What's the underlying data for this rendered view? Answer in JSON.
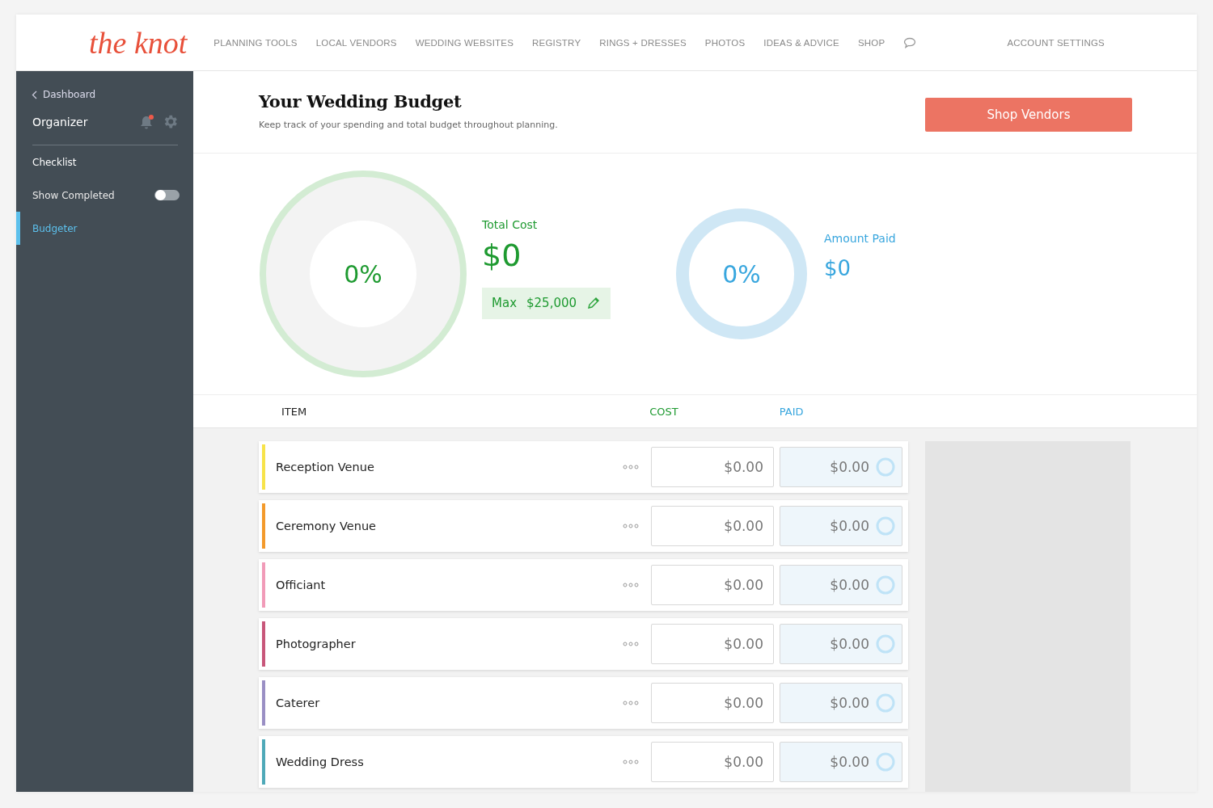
{
  "header": {
    "logo": "the knot",
    "nav": [
      "PLANNING TOOLS",
      "LOCAL VENDORS",
      "WEDDING WEBSITES",
      "REGISTRY",
      "RINGS + DRESSES",
      "PHOTOS",
      "IDEAS & ADVICE",
      "SHOP"
    ],
    "account": "ACCOUNT SETTINGS"
  },
  "sidebar": {
    "back": "Dashboard",
    "title": "Organizer",
    "notification": true,
    "items": [
      {
        "label": "Checklist",
        "kind": "link",
        "selected": false
      },
      {
        "label": "Show Completed",
        "kind": "toggle",
        "on": false
      },
      {
        "label": "Budgeter",
        "kind": "link",
        "selected": true
      }
    ]
  },
  "page": {
    "title": "Your Wedding Budget",
    "subtitle": "Keep track of your spending and total budget throughout planning.",
    "action": "Shop Vendors"
  },
  "total": {
    "percent": "0%",
    "level": 0,
    "label": "Total Cost",
    "amount": "$0",
    "max_label": "Max",
    "max_amount": "$25,000"
  },
  "paid": {
    "percent": "0%",
    "level": 0,
    "label": "Amount Paid",
    "amount": "$0"
  },
  "table": {
    "columns": [
      "ITEM",
      "COST",
      "PAID"
    ],
    "rows": [
      {
        "name": "Reception Venue",
        "color": "#f7e34a",
        "cost": "$0.00",
        "paid": "$0.00"
      },
      {
        "name": "Ceremony Venue",
        "color": "#f39a2b",
        "cost": "$0.00",
        "paid": "$0.00"
      },
      {
        "name": "Officiant",
        "color": "#f19bb8",
        "cost": "$0.00",
        "paid": "$0.00"
      },
      {
        "name": "Photographer",
        "color": "#c8577a",
        "cost": "$0.00",
        "paid": "$0.00"
      },
      {
        "name": "Caterer",
        "color": "#9a8fc4",
        "cost": "$0.00",
        "paid": "$0.00"
      },
      {
        "name": "Wedding Dress",
        "color": "#4fa9b8",
        "cost": "$0.00",
        "paid": "$0.00"
      }
    ]
  }
}
